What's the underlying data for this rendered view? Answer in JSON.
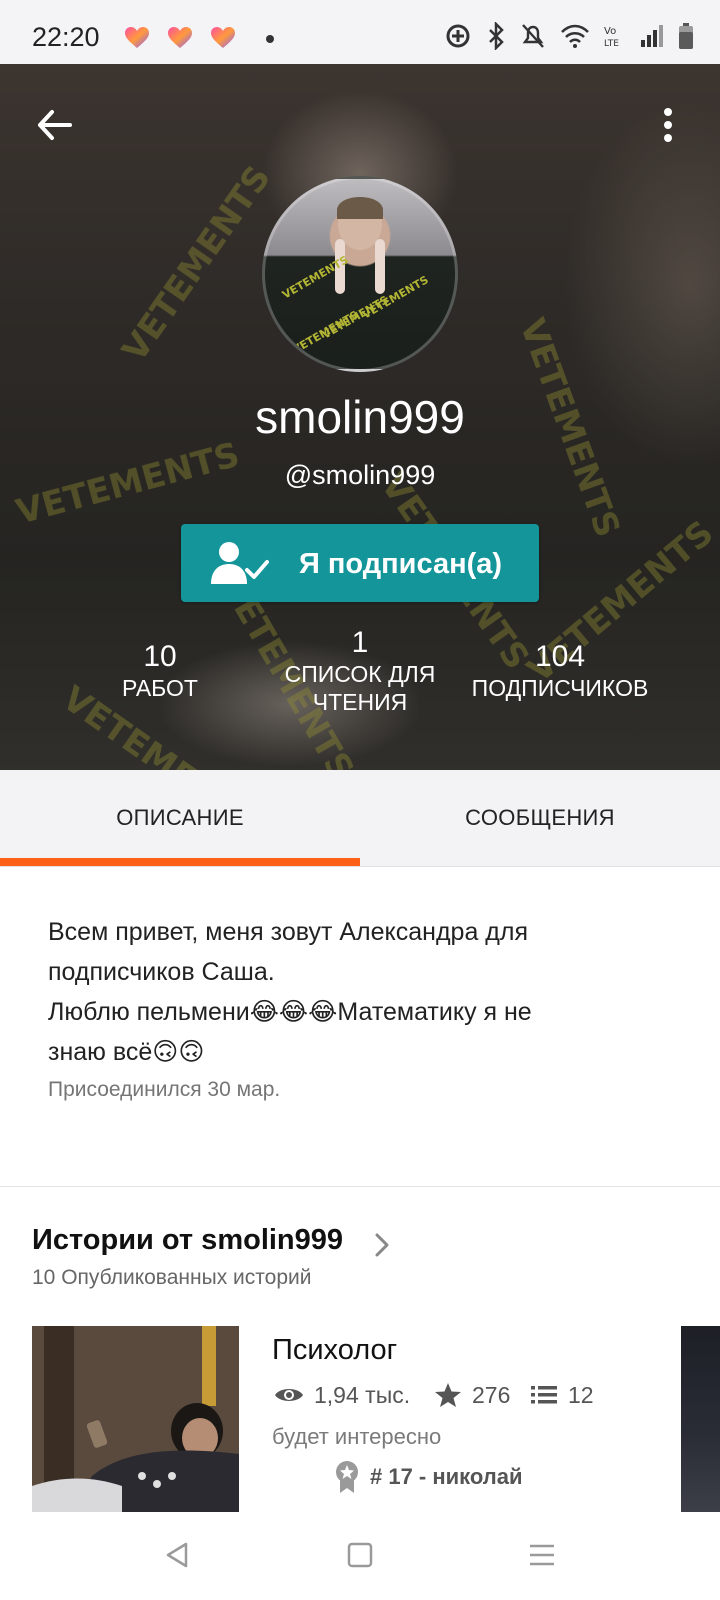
{
  "status_bar": {
    "time": "22:20",
    "icons": [
      "heart-app-icon",
      "heart-app-icon",
      "heart-app-icon",
      "notification-dot",
      "location-icon",
      "bluetooth-icon",
      "mute-icon",
      "wifi-icon",
      "volte-icon",
      "signal-icon",
      "battery-icon"
    ]
  },
  "header": {
    "back_icon": "arrow-left-icon",
    "menu_icon": "more-vertical-icon"
  },
  "profile": {
    "display_name": "smolin999",
    "handle": "@smolin999",
    "follow_button_label": "Я подписан(а)",
    "follow_icon": "user-check-icon",
    "stats": [
      {
        "value": "10",
        "label": "РАБОТ"
      },
      {
        "value": "1",
        "label_line1": "СПИСОК ДЛЯ",
        "label_line2": "ЧТЕНИЯ"
      },
      {
        "value": "104",
        "label": "ПОДПИСЧИКОВ"
      }
    ],
    "follow_button_color": "#13959a"
  },
  "tabs": {
    "items": [
      {
        "label": "ОПИСАНИЕ",
        "active": true
      },
      {
        "label": "СООБЩЕНИЯ",
        "active": false
      }
    ],
    "accent_color": "#ff6017"
  },
  "description": {
    "line1": "Всем привет, меня зовут Александра для",
    "line2": "подписчиков Саша.",
    "line3": "Люблю пельмени😂😂😂Математику я не",
    "line4": "знаю всё🙃🙃",
    "joined": "Присоединился 30 мар."
  },
  "stories": {
    "title": "Истории от smolin999",
    "subtitle": "10 Опубликованных историй",
    "items": [
      {
        "title": "Психолог",
        "views": "1,94 тыс.",
        "votes": "276",
        "parts": "12",
        "description": "будет интересно",
        "rank": "# 17 - николай"
      }
    ]
  },
  "nav_bar": {
    "icons": [
      "back-triangle-icon",
      "home-square-icon",
      "recents-menu-icon"
    ]
  }
}
